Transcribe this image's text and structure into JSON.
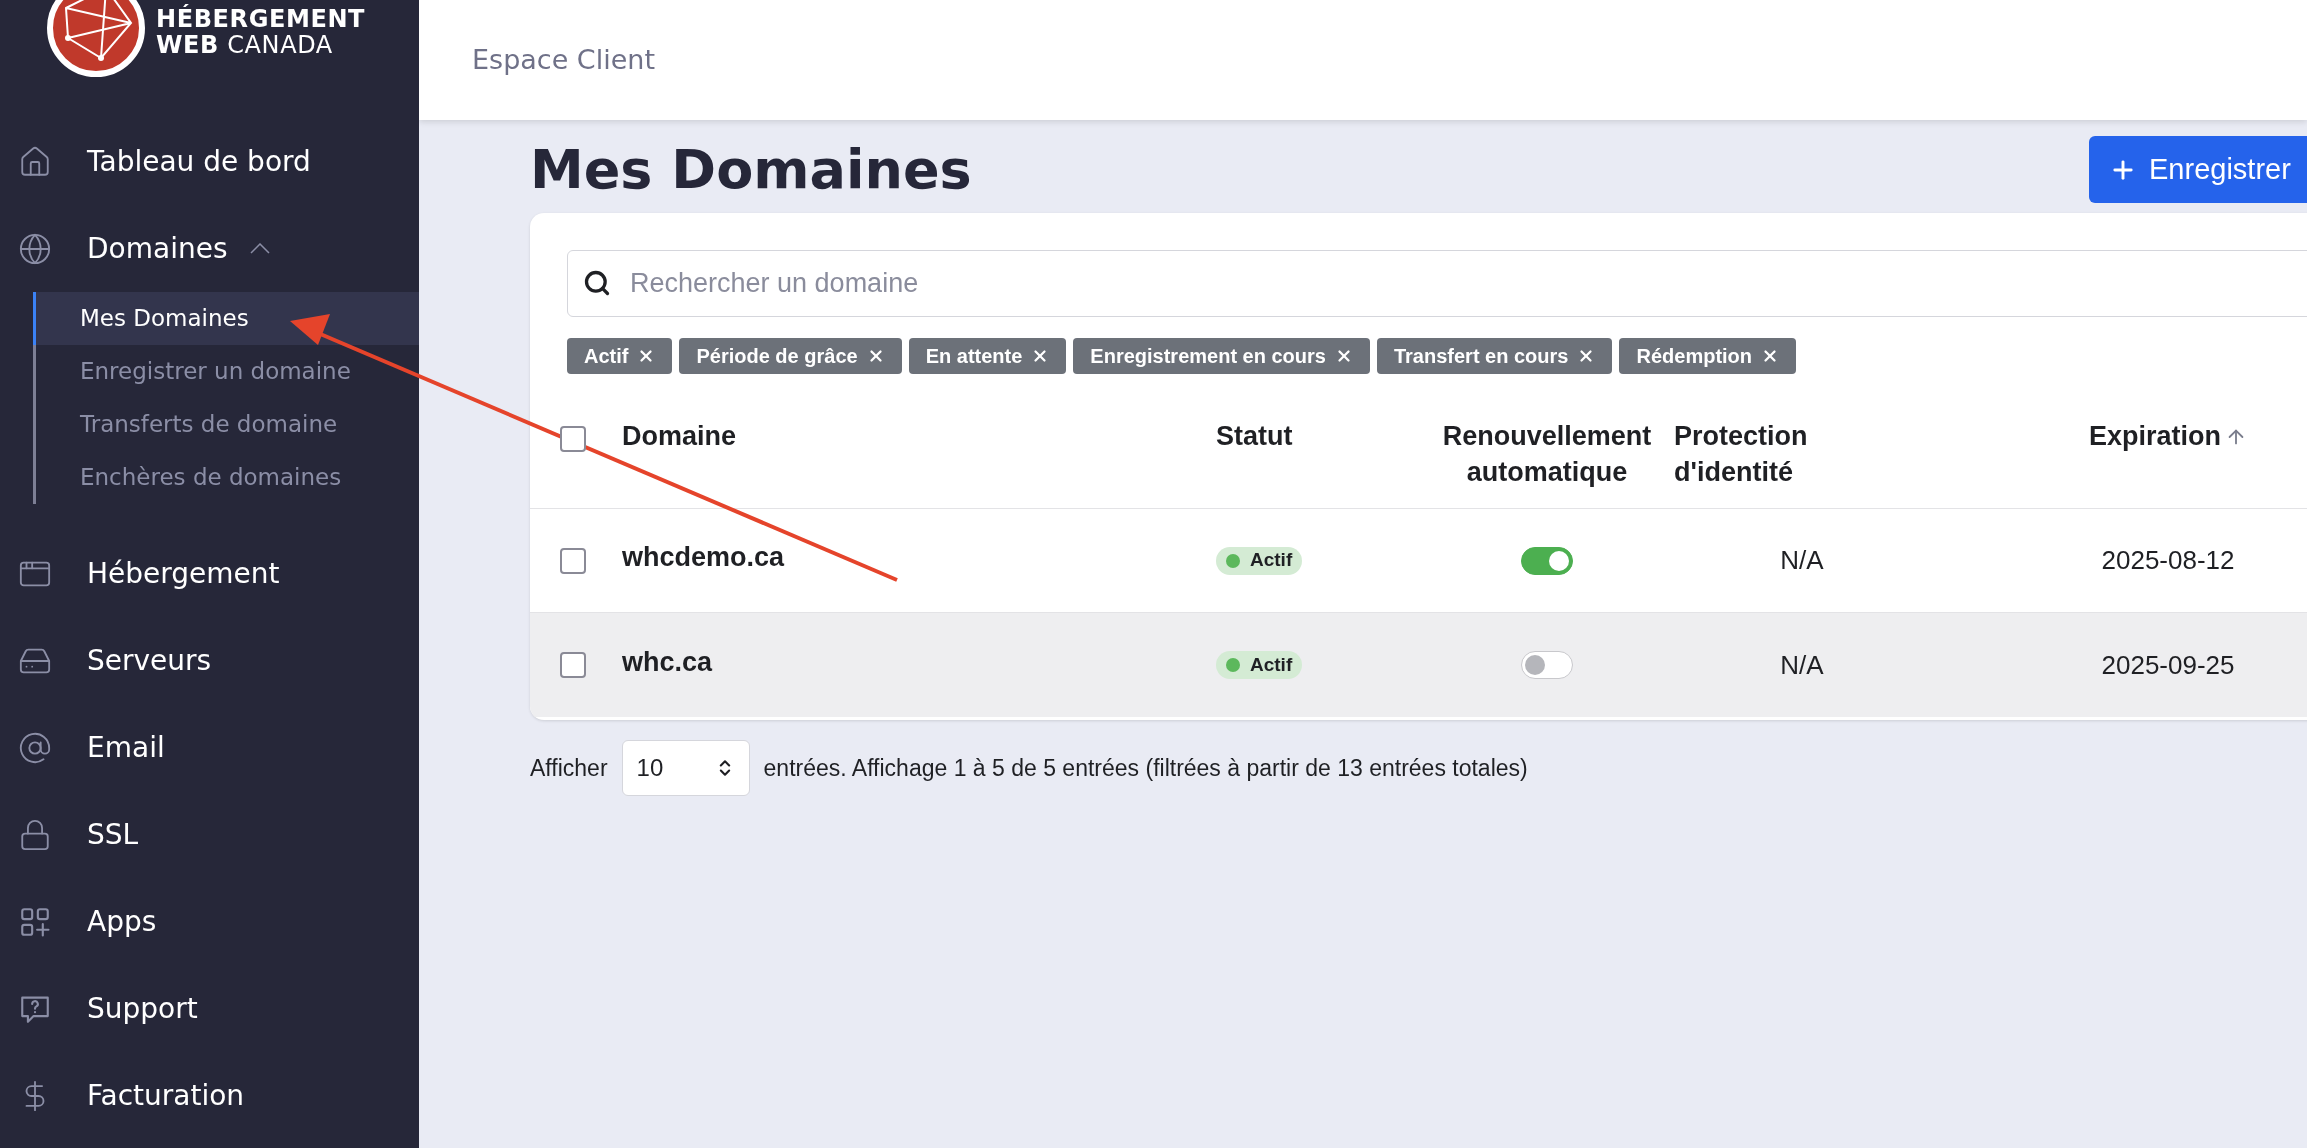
{
  "logo": {
    "line1": "HÉBERGEMENT",
    "line2": "**WEB** CANADA"
  },
  "sidebar": {
    "items": [
      {
        "label": "Tableau de bord"
      },
      {
        "label": "Domaines",
        "expanded": true,
        "children": [
          {
            "label": "Mes Domaines",
            "selected": true
          },
          {
            "label": "Enregistrer un domaine",
            "selected": false
          },
          {
            "label": "Transferts de domaine",
            "selected": false
          },
          {
            "label": "Enchères de domaines",
            "selected": false
          }
        ]
      },
      {
        "label": "Hébergement"
      },
      {
        "label": "Serveurs"
      },
      {
        "label": "Email"
      },
      {
        "label": "SSL"
      },
      {
        "label": "Apps"
      },
      {
        "label": "Support"
      },
      {
        "label": "Facturation"
      }
    ]
  },
  "header": {
    "title": "Espace Client"
  },
  "page": {
    "title": "Mes Domaines",
    "action_button": "Enregistrer"
  },
  "search": {
    "placeholder": "Rechercher un domaine"
  },
  "filters": [
    {
      "label": "Actif"
    },
    {
      "label": "Période de grâce"
    },
    {
      "label": "En attente"
    },
    {
      "label": "Enregistrement en cours"
    },
    {
      "label": "Transfert en cours"
    },
    {
      "label": "Rédemption"
    }
  ],
  "table": {
    "select_all_checked": false,
    "columns": [
      {
        "label": "Domaine",
        "sorted": false
      },
      {
        "label": "Statut",
        "sorted": false
      },
      {
        "label": "Renouvellement automatique",
        "sorted": false
      },
      {
        "label": "Protection d'identité",
        "sorted": false
      },
      {
        "label": "Expiration",
        "sorted": true
      }
    ],
    "rows": [
      {
        "checked": false,
        "highlighted": false,
        "domain": "whcdemo.ca",
        "status": "Actif",
        "color": "#5cb85c",
        "auto_renew": true,
        "privacy": "N/A",
        "expiration": "2025-08-12"
      },
      {
        "checked": false,
        "highlighted": true,
        "domain": "whc.ca",
        "status": "Actif",
        "color": "#5cb85c",
        "auto_renew": false,
        "privacy": "N/A",
        "expiration": "2025-09-25"
      }
    ]
  },
  "footer": {
    "show_label": "Afficher",
    "page_size": "10",
    "summary": "entrées. Affichage 1 à 5 de 5 entrées (filtrées à partir de 13 entrées totales)"
  }
}
